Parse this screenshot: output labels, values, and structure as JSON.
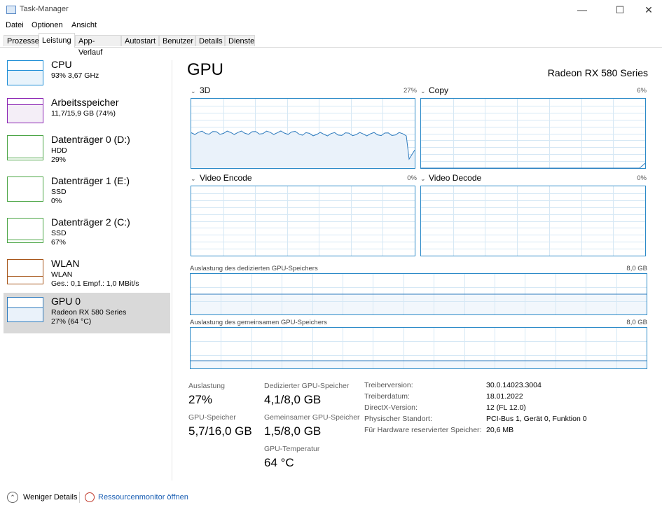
{
  "window": {
    "title": "Task-Manager",
    "minimize_glyph": "—",
    "maximize_glyph": "☐",
    "close_glyph": "✕"
  },
  "menu": [
    "Datei",
    "Optionen",
    "Ansicht"
  ],
  "tabs": [
    {
      "label": "Prozesse",
      "active": false
    },
    {
      "label": "Leistung",
      "active": true
    },
    {
      "label": "App-Verlauf",
      "active": false
    },
    {
      "label": "Autostart",
      "active": false
    },
    {
      "label": "Benutzer",
      "active": false
    },
    {
      "label": "Details",
      "active": false
    },
    {
      "label": "Dienste",
      "active": false
    }
  ],
  "devices": [
    {
      "name": "CPU",
      "line1": "93%  3,67 GHz",
      "line2": "",
      "line3": "",
      "color": "#1e8ed6",
      "fill": "#e8f3fb",
      "level": 0.6,
      "selected": false
    },
    {
      "name": "Arbeitsspeicher",
      "line1": "11,7/15,9 GB (74%)",
      "line2": "",
      "line3": "",
      "color": "#8b24b3",
      "fill": "#f4eef7",
      "level": 0.74,
      "selected": false
    },
    {
      "name": "Datenträger 0 (D:)",
      "line1": "HDD",
      "line2": "29%",
      "line3": "",
      "color": "#4ca646",
      "fill": "#ffffff",
      "level": 0.05,
      "selected": false
    },
    {
      "name": "Datenträger 1 (E:)",
      "line1": "SSD",
      "line2": "0%",
      "line3": "",
      "color": "#4ca646",
      "fill": "#ffffff",
      "level": 0.0,
      "selected": false
    },
    {
      "name": "Datenträger 2 (C:)",
      "line1": "SSD",
      "line2": "67%",
      "line3": "",
      "color": "#4ca646",
      "fill": "#ffffff",
      "level": 0.1,
      "selected": false
    },
    {
      "name": "WLAN",
      "line1": "WLAN",
      "line2": "Ges.: 0,1  Empf.: 1,0 MBit/s",
      "line3": "",
      "color": "#a7561a",
      "fill": "#ffffff",
      "level": 0.3,
      "selected": false
    },
    {
      "name": "GPU 0",
      "line1": "Radeon RX 580 Series",
      "line2": "27%  (64 °C)",
      "line3": "",
      "color": "#2e7bbd",
      "fill": "#eaf2fa",
      "level": 0.55,
      "selected": true
    }
  ],
  "gpu": {
    "title": "GPU",
    "model": "Radeon RX 580 Series",
    "engines": [
      {
        "label": "3D",
        "percent": "27%"
      },
      {
        "label": "Copy",
        "percent": "6%"
      },
      {
        "label": "Video Encode",
        "percent": "0%"
      },
      {
        "label": "Video Decode",
        "percent": "0%"
      }
    ],
    "dedicated_mem": {
      "label": "Auslastung des dedizierten GPU-Speichers",
      "max": "8,0 GB"
    },
    "shared_mem": {
      "label": "Auslastung des gemeinsamen GPU-Speichers",
      "max": "8,0 GB"
    },
    "stats": {
      "usage_label": "Auslastung",
      "usage_value": "27%",
      "gpumem_label": "GPU-Speicher",
      "gpumem_value": "5,7/16,0 GB",
      "dedicated_label": "Dedizierter GPU-Speicher",
      "dedicated_value": "4,1/8,0 GB",
      "shared_label": "Gemeinsamer GPU-Speicher",
      "shared_value": "1,5/8,0 GB",
      "temp_label": "GPU-Temperatur",
      "temp_value": "64 °C"
    },
    "driver": [
      {
        "label": "Treiberversion:",
        "value": "30.0.14023.3004"
      },
      {
        "label": "Treiberdatum:",
        "value": "18.01.2022"
      },
      {
        "label": "DirectX-Version:",
        "value": "12 (FL 12.0)"
      },
      {
        "label": "Physischer Standort:",
        "value": "PCI-Bus 1, Gerät 0, Funktion 0"
      },
      {
        "label": "Für Hardware reservierter Speicher:",
        "value": "20,6 MB"
      }
    ]
  },
  "footer": {
    "fewer_details": "Weniger Details",
    "resource_monitor": "Ressourcenmonitor öffnen"
  },
  "colors": {
    "graph_border": "#2c8ac8",
    "graph_grid": "#d6e8f5",
    "graph_line": "#2e7bbd",
    "graph_fill": "#eaf2fa"
  }
}
